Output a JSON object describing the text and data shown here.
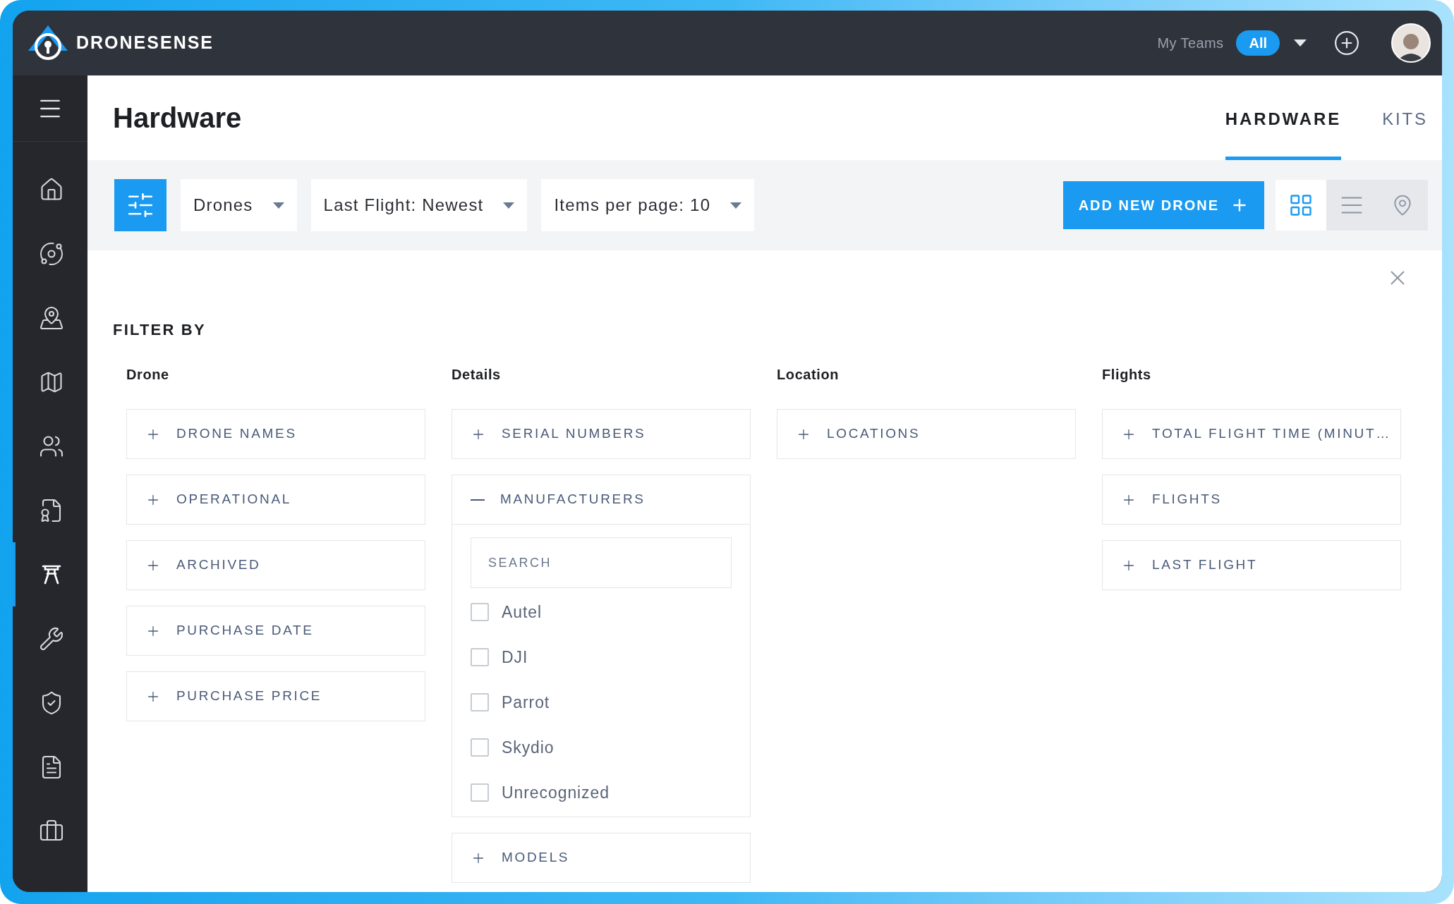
{
  "topbar": {
    "brand": "DRONESENSE",
    "teams_label": "My Teams",
    "teams_value": "All"
  },
  "sidebar": {
    "items": [
      {
        "selected": false
      },
      {
        "selected": false
      },
      {
        "selected": false
      },
      {
        "selected": false
      },
      {
        "selected": false
      },
      {
        "selected": false
      },
      {
        "selected": true
      },
      {
        "selected": false
      },
      {
        "selected": false
      },
      {
        "selected": false
      },
      {
        "selected": false
      }
    ]
  },
  "header": {
    "title": "Hardware",
    "tabs": [
      {
        "label": "HARDWARE",
        "selected": true
      },
      {
        "label": "KITS",
        "selected": false
      }
    ]
  },
  "toolbar": {
    "dropdowns": [
      "Drones",
      "Last Flight: Newest",
      "Items per page: 10"
    ],
    "add_button": "ADD NEW DRONE",
    "views": [
      {
        "kind": "grid",
        "selected": true
      },
      {
        "kind": "list",
        "selected": false
      },
      {
        "kind": "map",
        "selected": false
      }
    ]
  },
  "filter": {
    "title": "FILTER BY",
    "columns": [
      {
        "heading": "Drone",
        "filters": [
          {
            "label": "DRONE NAMES",
            "expanded": false
          },
          {
            "label": "OPERATIONAL",
            "expanded": false
          },
          {
            "label": "ARCHIVED",
            "expanded": false
          },
          {
            "label": "PURCHASE DATE",
            "expanded": false
          },
          {
            "label": "PURCHASE PRICE",
            "expanded": false
          }
        ]
      },
      {
        "heading": "Details",
        "filters": [
          {
            "label": "SERIAL NUMBERS",
            "expanded": false
          },
          {
            "label": "MANUFACTURERS",
            "expanded": true,
            "search_placeholder": "SEARCH",
            "options": [
              {
                "label": "Autel",
                "checked": false
              },
              {
                "label": "DJI",
                "checked": false
              },
              {
                "label": "Parrot",
                "checked": false
              },
              {
                "label": "Skydio",
                "checked": false
              },
              {
                "label": "Unrecognized",
                "checked": false
              }
            ]
          },
          {
            "label": "MODELS",
            "expanded": false
          }
        ]
      },
      {
        "heading": "Location",
        "filters": [
          {
            "label": "LOCATIONS",
            "expanded": false
          }
        ]
      },
      {
        "heading": "Flights",
        "filters": [
          {
            "label": "TOTAL FLIGHT TIME (MINUT…",
            "expanded": false
          },
          {
            "label": "FLIGHTS",
            "expanded": false
          },
          {
            "label": "LAST FLIGHT",
            "expanded": false
          }
        ]
      }
    ]
  }
}
